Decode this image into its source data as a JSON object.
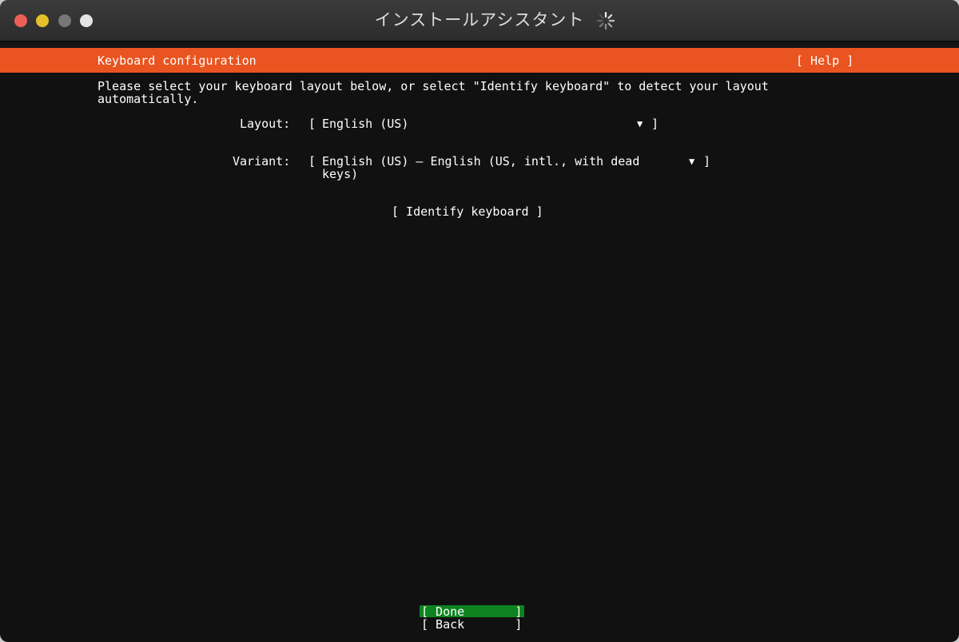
{
  "window": {
    "title": "インストールアシスタント"
  },
  "colors": {
    "header": "#e95420",
    "background": "#111111",
    "focus": "#0e8420",
    "text": "#ffffff"
  },
  "header": {
    "title": "Keyboard configuration",
    "help_label": "[ Help ]"
  },
  "intro": {
    "line1": "Please select your keyboard layout below, or select \"Identify keyboard\" to detect your layout",
    "line2": "automatically."
  },
  "layout_field": {
    "label": "Layout:",
    "open_bracket": "[",
    "value": "English (US)",
    "arrow": "▼",
    "close_bracket": "]"
  },
  "variant_field": {
    "label": "Variant:",
    "open_bracket": "[",
    "value_line1": "English (US) – English (US, intl., with dead",
    "value_line2": "keys)",
    "arrow": "▼",
    "close_bracket": "]"
  },
  "identify_button": {
    "label": "[ Identify keyboard ]"
  },
  "footer": {
    "done_label": "[ Done       ]",
    "back_label": "[ Back       ]"
  }
}
